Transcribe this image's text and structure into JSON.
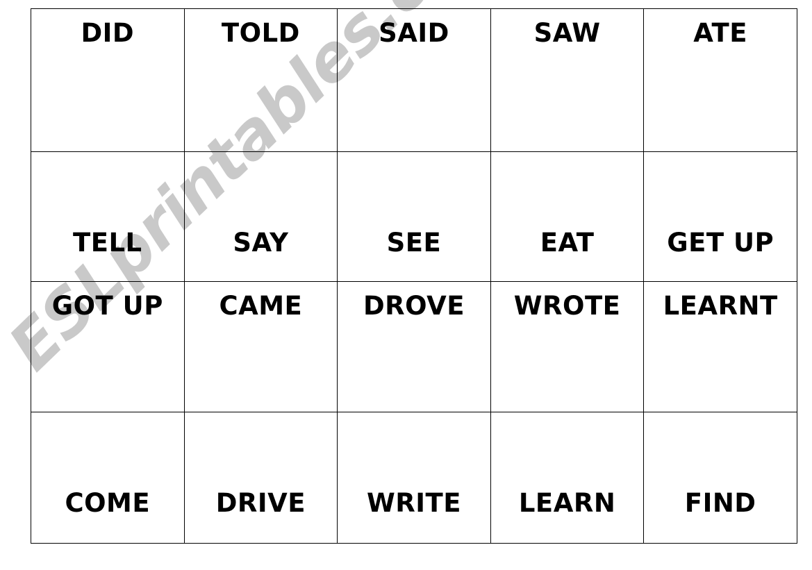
{
  "page": {
    "background_color": "#ffffff",
    "text_color": "#000000",
    "border_color": "#000000"
  },
  "watermark": {
    "text": "ESLprintables.com",
    "color": "#c9c9c9",
    "rotation_degrees": -44
  },
  "worksheet": {
    "columns": 5,
    "rows": 4,
    "cells": [
      [
        {
          "word": "DID",
          "align": "top"
        },
        {
          "word": "TOLD",
          "align": "top"
        },
        {
          "word": "SAID",
          "align": "top"
        },
        {
          "word": "SAW",
          "align": "top"
        },
        {
          "word": "ATE",
          "align": "top"
        }
      ],
      [
        {
          "word": "TELL",
          "align": "bottom"
        },
        {
          "word": "SAY",
          "align": "bottom"
        },
        {
          "word": "SEE",
          "align": "bottom"
        },
        {
          "word": "EAT",
          "align": "bottom"
        },
        {
          "word": "GET UP",
          "align": "bottom"
        }
      ],
      [
        {
          "word": "GOT UP",
          "align": "top"
        },
        {
          "word": "CAME",
          "align": "top"
        },
        {
          "word": "DROVE",
          "align": "top"
        },
        {
          "word": "WROTE",
          "align": "top"
        },
        {
          "word": "LEARNT",
          "align": "top"
        }
      ],
      [
        {
          "word": "COME",
          "align": "bottom"
        },
        {
          "word": "DRIVE",
          "align": "bottom"
        },
        {
          "word": "WRITE",
          "align": "bottom"
        },
        {
          "word": "LEARN",
          "align": "bottom"
        },
        {
          "word": "FIND",
          "align": "bottom"
        }
      ]
    ]
  }
}
